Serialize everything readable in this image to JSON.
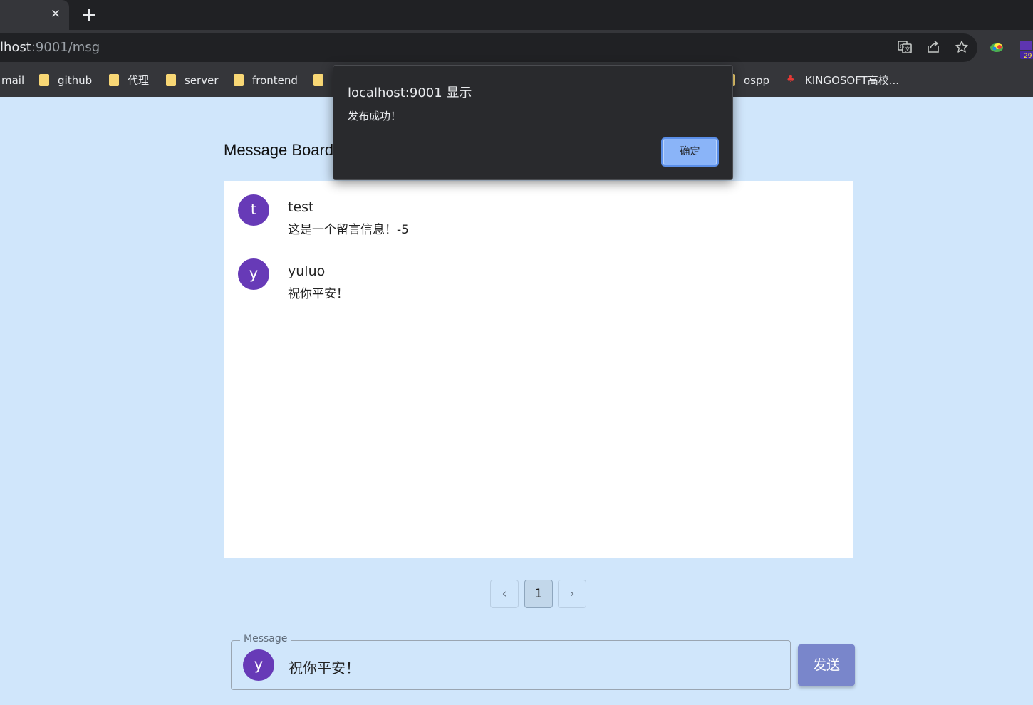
{
  "browser": {
    "close_glyph": "✕",
    "new_tab_glyph": "+",
    "url_host": "lhost",
    "url_path": ":9001/msg",
    "icons": [
      "translate-icon",
      "share-icon",
      "star-icon",
      "colorful-extension-icon",
      "purple-extension-icon"
    ],
    "purple_ext_badge": "29"
  },
  "bookmarks": [
    {
      "label": "mail",
      "folder": false
    },
    {
      "label": "github",
      "folder": true
    },
    {
      "label": "代理",
      "folder": true
    },
    {
      "label": "server",
      "folder": true
    },
    {
      "label": "frontend",
      "folder": true
    },
    {
      "label": "",
      "folder": true
    },
    {
      "label": "ospp",
      "folder": true
    },
    {
      "label": "KINGOSOFT高校...",
      "folder": false
    }
  ],
  "page": {
    "title": "Message Board"
  },
  "messages": [
    {
      "initial": "t",
      "user": "test",
      "text": "这是一个留言信息！-5"
    },
    {
      "initial": "y",
      "user": "yuluo",
      "text": "祝你平安！"
    }
  ],
  "pagination": {
    "prev": "‹",
    "current": "1",
    "next": "›"
  },
  "input": {
    "label": "Message",
    "avatar_initial": "y",
    "value": "祝你平安！"
  },
  "send_button": "发送",
  "dialog": {
    "title": "localhost:9001 显示",
    "message": "发布成功！",
    "ok": "确定"
  },
  "colors": {
    "page_bg": "#d0e6fb",
    "avatar": "#673ab7",
    "send_button": "#7986cb",
    "dialog_bg": "#292a2d",
    "dialog_ok": "#8ab4f8"
  }
}
